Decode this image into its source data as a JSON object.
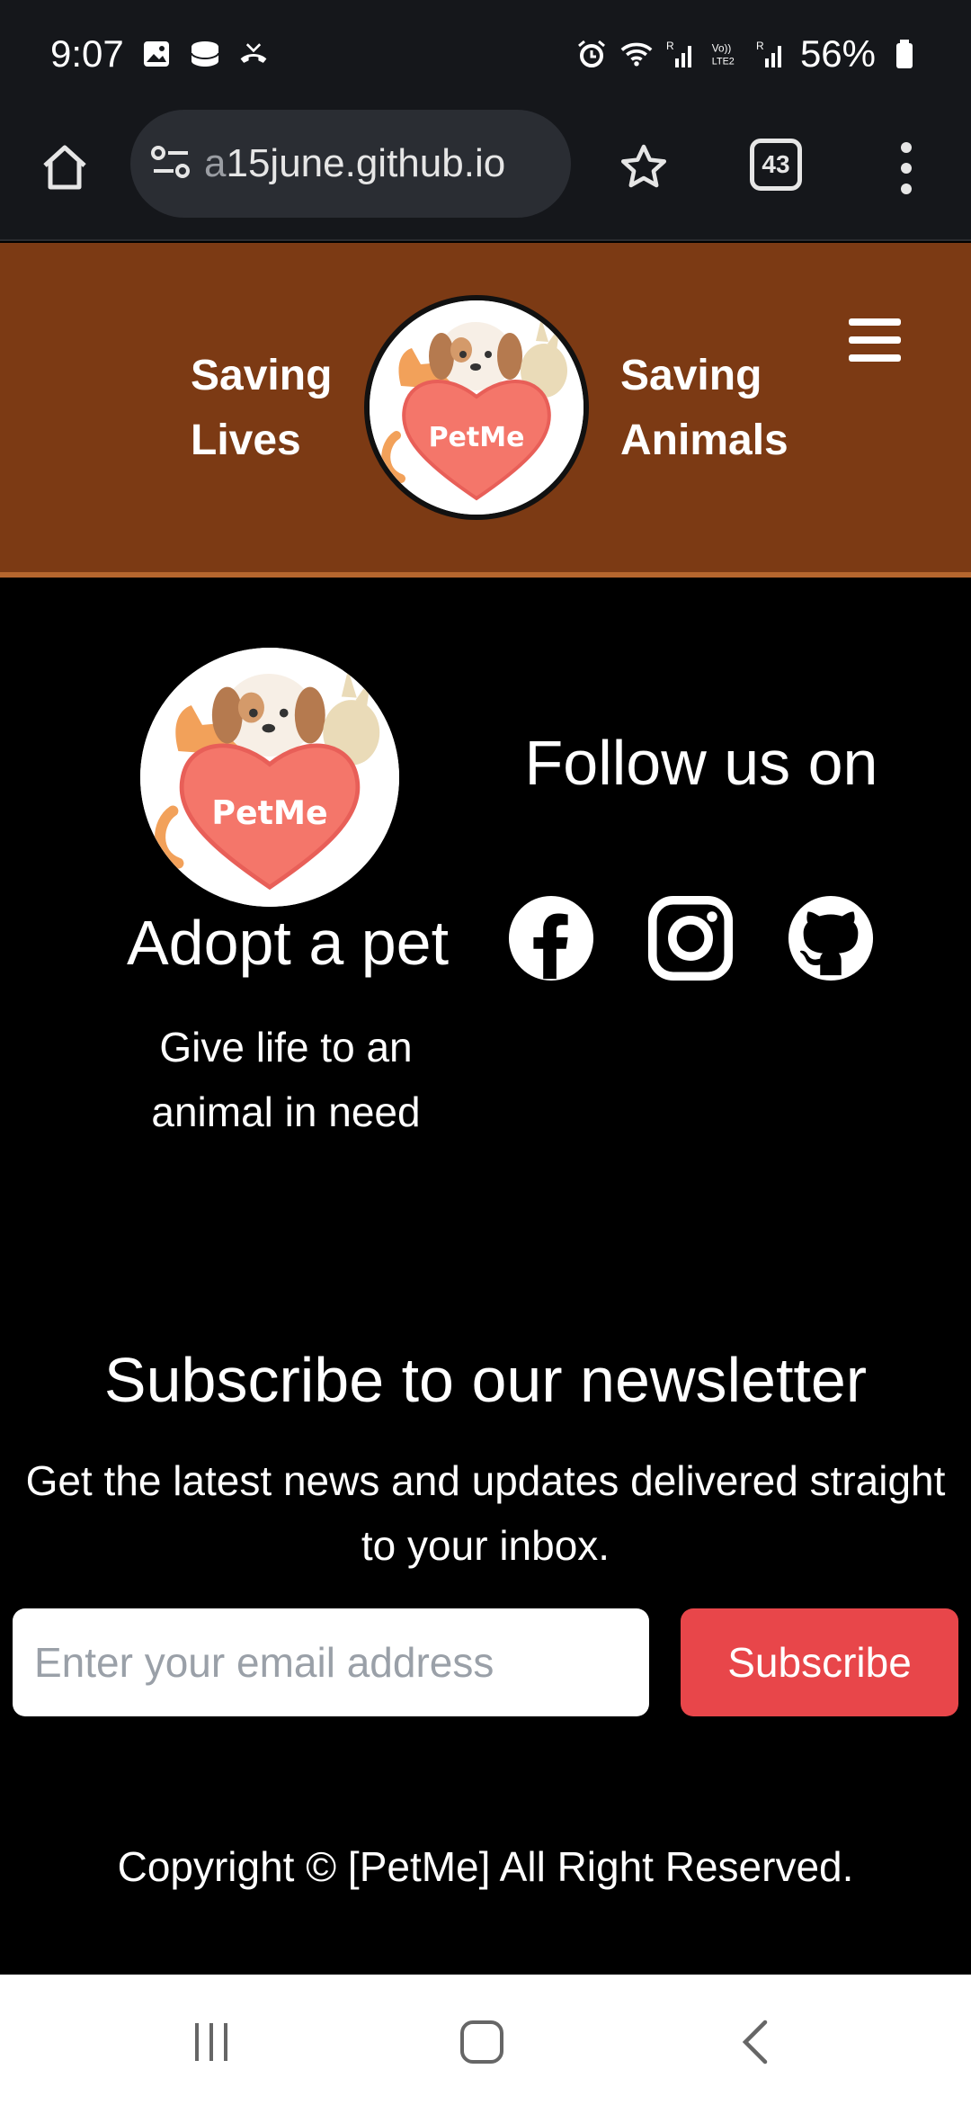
{
  "status_bar": {
    "time": "9:07",
    "battery": "56%",
    "icons": [
      "image-icon",
      "storage-icon",
      "missed-call-icon",
      "alarm-icon",
      "wifi-icon",
      "signal-icon",
      "volte-icon",
      "signal-icon",
      "battery-icon"
    ]
  },
  "browser": {
    "url_fade": "a",
    "url": "15june.github.io",
    "tab_count": "43"
  },
  "header": {
    "tagline_left_1": "Saving",
    "tagline_left_2": "Lives",
    "tagline_right_1": "Saving",
    "tagline_right_2": "Animals",
    "logo_text": "PetMe"
  },
  "footer": {
    "logo_text": "PetMe",
    "adopt_title": "Adopt a pet",
    "adopt_sub_1": "Give life to an",
    "adopt_sub_2": "animal in need",
    "follow_title": "Follow us on",
    "social": [
      "facebook-icon",
      "instagram-icon",
      "github-icon"
    ]
  },
  "newsletter": {
    "title": "Subscribe to our newsletter",
    "sub_1": "Get the latest news and updates delivered straight",
    "sub_2": "to your inbox.",
    "email_placeholder": "Enter your email address",
    "button_label": "Subscribe"
  },
  "copyright": "Copyright © [PetMe] All Right Reserved.",
  "colors": {
    "header_bg": "#7c3a14",
    "accent_red": "#e8464a",
    "heart": "#f4766a"
  }
}
